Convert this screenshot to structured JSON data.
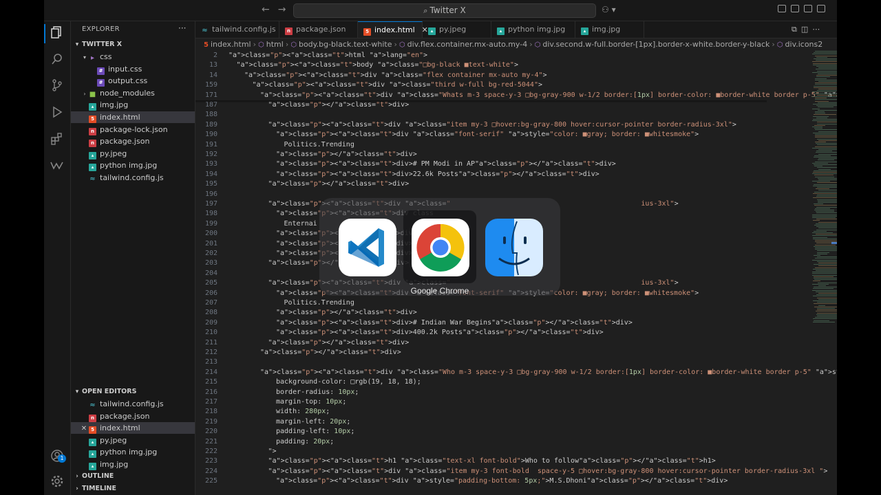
{
  "window": {
    "search_text": "Twitter X"
  },
  "explorer": {
    "title": "EXPLORER",
    "project": "TWITTER X",
    "tree": [
      {
        "label": "css",
        "icon": "folder-icon",
        "depth": 1,
        "kind": "folder-open"
      },
      {
        "label": "input.css",
        "icon": "css-file-icon",
        "depth": 2
      },
      {
        "label": "output.css",
        "icon": "css-file-icon",
        "depth": 2
      },
      {
        "label": "node_modules",
        "icon": "node-folder-icon",
        "depth": 1,
        "kind": "folder"
      },
      {
        "label": "img.jpg",
        "icon": "image-file-icon",
        "depth": 1
      },
      {
        "label": "index.html",
        "icon": "html-file-icon",
        "depth": 1,
        "selected": true
      },
      {
        "label": "package-lock.json",
        "icon": "npm-file-icon",
        "depth": 1
      },
      {
        "label": "package.json",
        "icon": "npm-file-icon",
        "depth": 1
      },
      {
        "label": "py.jpeg",
        "icon": "image-file-icon",
        "depth": 1
      },
      {
        "label": "python img.jpg",
        "icon": "image-file-icon",
        "depth": 1
      },
      {
        "label": "tailwind.config.js",
        "icon": "tailwind-file-icon",
        "depth": 1
      }
    ],
    "open_editors_title": "OPEN EDITORS",
    "open_editors": [
      {
        "label": "tailwind.config.js",
        "icon": "tailwind-file-icon"
      },
      {
        "label": "package.json",
        "icon": "npm-file-icon"
      },
      {
        "label": "index.html",
        "icon": "html-file-icon",
        "selected": true
      },
      {
        "label": "py.jpeg",
        "icon": "image-file-icon"
      },
      {
        "label": "python img.jpg",
        "icon": "image-file-icon"
      },
      {
        "label": "img.jpg",
        "icon": "image-file-icon"
      }
    ],
    "outline_title": "OUTLINE",
    "timeline_title": "TIMELINE",
    "accounts_badge": "1"
  },
  "tabs": [
    {
      "label": "tailwind.config.js",
      "icon": "tailwind-file-icon"
    },
    {
      "label": "package.json",
      "icon": "npm-file-icon"
    },
    {
      "label": "index.html",
      "icon": "html-file-icon",
      "active": true
    },
    {
      "label": "py.jpeg",
      "icon": "image-file-icon"
    },
    {
      "label": "python img.jpg",
      "icon": "image-file-icon"
    },
    {
      "label": "img.jpg",
      "icon": "image-file-icon"
    }
  ],
  "breadcrumb": [
    "index.html",
    "html",
    "body.bg-black.text-white",
    "div.flex.container.mx-auto.my-4",
    "div.second.w-full.border-[1px].border-x-white.border-y-black",
    "div.icons2"
  ],
  "code_lines": [
    {
      "n": "2",
      "indent": 0,
      "text": "<html lang=\"en\">",
      "sticky": true
    },
    {
      "n": "13",
      "indent": 1,
      "text": "<body class=\"□bg-black ■text-white\">",
      "sticky": true
    },
    {
      "n": "14",
      "indent": 2,
      "text": "<div class=\"flex container mx-auto my-4\">",
      "sticky": true
    },
    {
      "n": "159",
      "indent": 3,
      "text": "<div class=\"third w-full bg-red-5044\">",
      "sticky": true
    },
    {
      "n": "171",
      "indent": 4,
      "text": "<div class=\"Whats m-3 space-y-3 □bg-gray-900 w-1/2 border:[1px] border-color: ■border-white border p-5\" style=\"",
      "sticky": true
    },
    {
      "n": "187",
      "indent": 5,
      "text": "</div>"
    },
    {
      "n": "188",
      "indent": 5,
      "text": ""
    },
    {
      "n": "189",
      "indent": 5,
      "text": "<div class=\"item my-3 □hover:bg-gray-800 hover:cursor-pointer border-radius-3xl\">"
    },
    {
      "n": "190",
      "indent": 6,
      "text": "<div class=\"font-serif\" style=\"color: ■gray; border: ■whitesmoke\">"
    },
    {
      "n": "191",
      "indent": 7,
      "text": "Politics.Trending"
    },
    {
      "n": "192",
      "indent": 6,
      "text": "</div>"
    },
    {
      "n": "193",
      "indent": 6,
      "text": "<div># PM Modi in AP</div>"
    },
    {
      "n": "194",
      "indent": 6,
      "text": "<div>22.6k Posts</div>"
    },
    {
      "n": "195",
      "indent": 5,
      "text": "</div>"
    },
    {
      "n": "196",
      "indent": 5,
      "text": ""
    },
    {
      "n": "197",
      "indent": 5,
      "text": "<div class=\"                                              ius-3xl\">"
    },
    {
      "n": "198",
      "indent": 6,
      "text": "<div class"
    },
    {
      "n": "199",
      "indent": 7,
      "text": "Enternai"
    },
    {
      "n": "200",
      "indent": 6,
      "text": "</div>"
    },
    {
      "n": "201",
      "indent": 6,
      "text": "<div># Mah"
    },
    {
      "n": "202",
      "indent": 6,
      "text": "<div>140.8"
    },
    {
      "n": "203",
      "indent": 5,
      "text": "</div>"
    },
    {
      "n": "204",
      "indent": 5,
      "text": ""
    },
    {
      "n": "205",
      "indent": 5,
      "text": "<div class=\"                                              ius-3xl\">"
    },
    {
      "n": "206",
      "indent": 6,
      "text": "<div class=\"font-serif\" style=\"color: ■gray; border: ■whitesmoke\">"
    },
    {
      "n": "207",
      "indent": 7,
      "text": "Politics.Trending"
    },
    {
      "n": "208",
      "indent": 6,
      "text": "</div>"
    },
    {
      "n": "209",
      "indent": 6,
      "text": "<div># Indian War Begins</div>"
    },
    {
      "n": "210",
      "indent": 6,
      "text": "<div>400.2k Posts</div>"
    },
    {
      "n": "211",
      "indent": 5,
      "text": "</div>"
    },
    {
      "n": "212",
      "indent": 4,
      "text": "</div>"
    },
    {
      "n": "213",
      "indent": 4,
      "text": ""
    },
    {
      "n": "214",
      "indent": 4,
      "text": "<div class=\"Who m-3 space-y-3 □bg-gray-900 w-1/2 border:[1px] border-color: ■border-white border p-5\" style=\""
    },
    {
      "n": "215",
      "indent": 6,
      "text": "background-color: □rgb(19, 18, 18);"
    },
    {
      "n": "216",
      "indent": 6,
      "text": "border-radius: 10px;"
    },
    {
      "n": "217",
      "indent": 6,
      "text": "margin-top: 10px;"
    },
    {
      "n": "218",
      "indent": 6,
      "text": "width: 280px;"
    },
    {
      "n": "219",
      "indent": 6,
      "text": "margin-left: 20px;"
    },
    {
      "n": "220",
      "indent": 6,
      "text": "padding-left: 10px;"
    },
    {
      "n": "221",
      "indent": 6,
      "text": "padding: 20px;"
    },
    {
      "n": "222",
      "indent": 5,
      "text": "\">"
    },
    {
      "n": "223",
      "indent": 5,
      "text": "<h1 class=\"text-xl font-bold\">Who to follow</h1>"
    },
    {
      "n": "224",
      "indent": 5,
      "text": "<div class=\"item my-3 font-bold  space-y-5 □hover:bg-gray-800 hover:cursor-pointer border-radius-3xl \">"
    },
    {
      "n": "225",
      "indent": 6,
      "text": "<div style=\"padding-bottom: 5px;\">M.S.Dhoni</div>"
    }
  ],
  "app_switcher": {
    "apps": [
      {
        "name": "Visual Studio Code",
        "icon": "vscode-icon"
      },
      {
        "name": "Google Chrome",
        "icon": "chrome-icon",
        "selected": true
      },
      {
        "name": "Finder",
        "icon": "finder-icon"
      }
    ],
    "selected_label": "Google Chrome"
  }
}
